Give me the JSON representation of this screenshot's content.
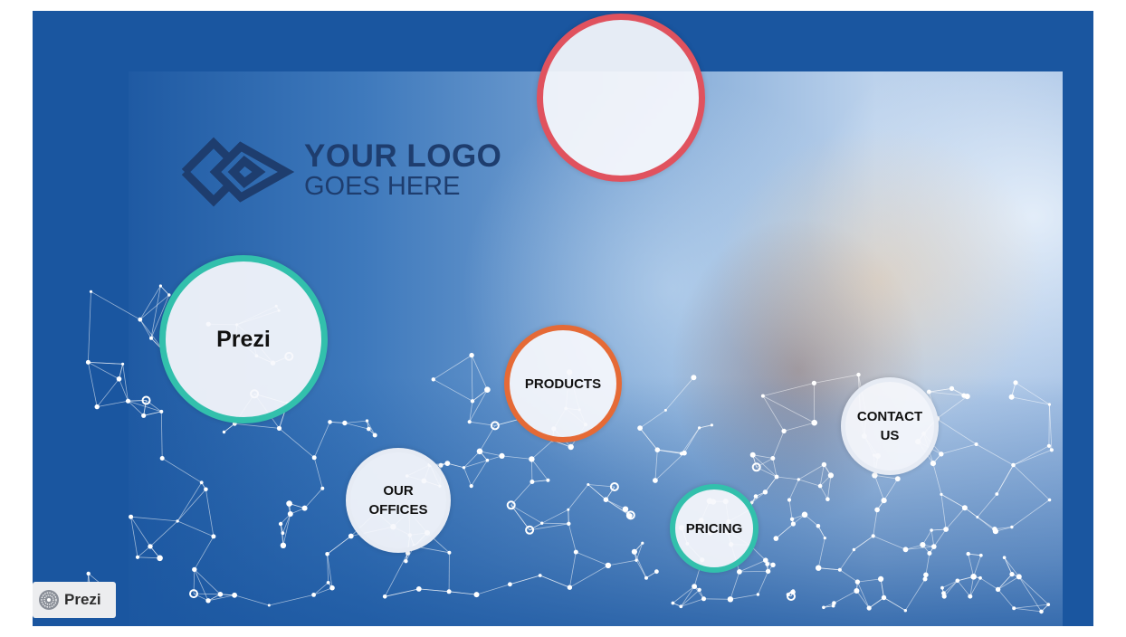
{
  "slide": {
    "logo": {
      "line1": "YOUR LOGO",
      "line2": "GOES HERE",
      "color": "#1e3d6e"
    },
    "frames": {
      "top": {
        "label": "",
        "color": "#e0525e"
      },
      "prezi": {
        "label": "Prezi",
        "color": "#32c0ac"
      },
      "products": {
        "label": "PRODUCTS",
        "color": "#e56a36"
      },
      "offices": {
        "label": "OUR\nOFFICES",
        "color": "#e6ebf4"
      },
      "contact": {
        "label": "CONTACT\nUS",
        "color": "#e6ebf4"
      },
      "pricing": {
        "label": "PRICING",
        "color": "#32c0ac"
      }
    },
    "background_color": "#1a56a0"
  },
  "badge": {
    "icon": "prezi-logo-icon",
    "label": "Prezi"
  }
}
